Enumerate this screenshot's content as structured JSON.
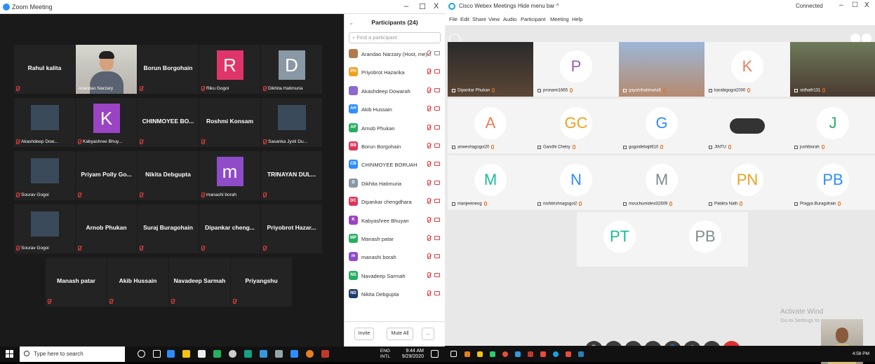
{
  "zoom": {
    "window_title": "Zoom Meeting",
    "window_controls": {
      "minimize": "–",
      "restore": "☐",
      "close": "X"
    },
    "grid": [
      {
        "name": "Rahul kalita",
        "caption": "",
        "type": "name",
        "muted": true
      },
      {
        "name": "",
        "caption": "Arandao Narzary",
        "type": "video",
        "highlight": true,
        "muted": false
      },
      {
        "name": "Borun Borgohain",
        "caption": "",
        "type": "name",
        "muted": true
      },
      {
        "name": "R",
        "caption": "Riku Gogoi",
        "type": "avatar",
        "color": "#e0356b",
        "muted": true
      },
      {
        "name": "D",
        "caption": "Dikhita Hatimuria",
        "type": "avatar",
        "color": "#8a97a5",
        "muted": true
      },
      {
        "name": "",
        "caption": "Akashdeep Dow...",
        "type": "photo",
        "muted": true
      },
      {
        "name": "K",
        "caption": "Kabyashree Bhuy...",
        "type": "avatar",
        "color": "#9a44c4",
        "muted": true
      },
      {
        "name": "CHINMOYEE BO...",
        "caption": "",
        "type": "name",
        "muted": true
      },
      {
        "name": "Roshmi Konsam",
        "caption": "",
        "type": "name",
        "muted": true
      },
      {
        "name": "",
        "caption": "Sasanka Jyoti Du...",
        "type": "photo",
        "muted": true
      },
      {
        "name": "",
        "caption": "Sourav Gogoi",
        "type": "photo",
        "muted": true
      },
      {
        "name": "Priyam Polly Go...",
        "caption": "",
        "type": "name",
        "muted": true
      },
      {
        "name": "Nikita Debgupta",
        "caption": "",
        "type": "name",
        "muted": true
      },
      {
        "name": "m",
        "caption": "manashi borah",
        "type": "avatar",
        "color": "#8e4cc9",
        "muted": true
      },
      {
        "name": "TRINAYAN DUL...",
        "caption": "",
        "type": "name",
        "muted": true
      },
      {
        "name": "",
        "caption": "Sourav Gogoi",
        "type": "photo",
        "muted": true
      },
      {
        "name": "Arnob Phukan",
        "caption": "",
        "type": "name",
        "muted": true
      },
      {
        "name": "Suraj Buragohain",
        "caption": "",
        "type": "name",
        "muted": true
      },
      {
        "name": "Dipankar cheng...",
        "caption": "",
        "type": "name",
        "muted": true
      },
      {
        "name": "Priyobrot Hazar...",
        "caption": "",
        "type": "name",
        "muted": true
      },
      {
        "name": "Manash patar",
        "caption": "",
        "type": "name",
        "muted": true
      },
      {
        "name": "Akib Hussain",
        "caption": "",
        "type": "name",
        "muted": true
      },
      {
        "name": "Navadeep Sarmah",
        "caption": "",
        "type": "name",
        "muted": true
      },
      {
        "name": "Priyangshu",
        "caption": "",
        "type": "name",
        "muted": true
      }
    ],
    "participants": {
      "title": "Participants (24)",
      "search_placeholder": "Find a participant",
      "list": [
        {
          "initials": "",
          "name": "Arandao Narzary (Host, me)",
          "color": "#b07a4a",
          "muted": false
        },
        {
          "initials": "PH",
          "name": "Priyobrot Hazarika",
          "color": "#f0a020",
          "muted": true
        },
        {
          "initials": "",
          "name": "Akashdeep Dowarah",
          "color": "#8a6ad0",
          "muted": true
        },
        {
          "initials": "AH",
          "name": "Akib Hussain",
          "color": "#2d8cff",
          "muted": true
        },
        {
          "initials": "AP",
          "name": "Arnob Phukan",
          "color": "#27ae60",
          "muted": true
        },
        {
          "initials": "BB",
          "name": "Borun Borgohain",
          "color": "#e0355a",
          "muted": true
        },
        {
          "initials": "CB",
          "name": "CHINMOYEE BORUAH",
          "color": "#2d8cff",
          "muted": true
        },
        {
          "initials": "D",
          "name": "Dikhita Hatimuria",
          "color": "#8a97a5",
          "muted": true
        },
        {
          "initials": "DC",
          "name": "Dipankar chengdhara",
          "color": "#e0355a",
          "muted": true
        },
        {
          "initials": "K",
          "name": "Kabyashree Bhuyan",
          "color": "#9a44c4",
          "muted": true
        },
        {
          "initials": "MP",
          "name": "Manash patar",
          "color": "#27ae60",
          "muted": true
        },
        {
          "initials": "m",
          "name": "manashi borah",
          "color": "#8e4cc9",
          "muted": true
        },
        {
          "initials": "NS",
          "name": "Navadeep Sarmah",
          "color": "#27ae60",
          "muted": true
        },
        {
          "initials": "ND",
          "name": "Nikita Debgupta",
          "color": "#1f3a6e",
          "muted": true
        }
      ],
      "invite_label": "Invite",
      "mute_all_label": "Mute All",
      "more_label": "..."
    },
    "taskbar": {
      "search_placeholder": "Type here to search",
      "lang": "ENG",
      "region": "INTL",
      "time": "9:44 AM",
      "date": "9/29/2020"
    }
  },
  "webex": {
    "window_title": "Cisco Webex Meetings",
    "hide_menu": "Hide menu bar ^",
    "status": "Connected",
    "window_controls": {
      "minimize": "–",
      "restore": "☐",
      "close": "X"
    },
    "menu": [
      "File",
      "Edit",
      "Share",
      "View",
      "Audio",
      "Participant",
      "Meeting",
      "Help"
    ],
    "tiles": [
      {
        "initials": "",
        "label": "Dipankar Phukan",
        "video": true,
        "color": ""
      },
      {
        "initials": "P",
        "label": "pronami1665",
        "video": false,
        "color": "#9b59b6"
      },
      {
        "initials": "",
        "label": "gayatrihatimuria5",
        "video": true,
        "color": ""
      },
      {
        "initials": "K",
        "label": "karabigogoi2000",
        "video": false,
        "color": "#e67e5e"
      },
      {
        "initials": "",
        "label": "sidhath131",
        "video": true,
        "color": ""
      },
      {
        "initials": "A",
        "label": "anweshagogoi20",
        "video": false,
        "color": "#e67e5e"
      },
      {
        "initials": "GC",
        "label": "Gandhi Chetry",
        "video": false,
        "color": "#f0a020"
      },
      {
        "initials": "G",
        "label": "gogoidebajit610",
        "video": false,
        "color": "#2d8cff"
      },
      {
        "initials": "",
        "label": "JINTU",
        "video": false,
        "color": ""
      },
      {
        "initials": "J",
        "label": "jushiborah",
        "video": false,
        "color": "#27ae60"
      },
      {
        "initials": "M",
        "label": "manjeetneog",
        "video": false,
        "color": "#1abc9c"
      },
      {
        "initials": "N",
        "label": "nishitrishnagogoi2",
        "video": false,
        "color": "#2d8cff"
      },
      {
        "initials": "M",
        "label": "mouchumidevi32609",
        "video": false,
        "color": "#7f8c8d"
      },
      {
        "initials": "PN",
        "label": "Pabitra Nath",
        "video": false,
        "color": "#f0a020"
      },
      {
        "initials": "PB",
        "label": "Pragya Buragohain",
        "video": false,
        "color": "#2d8cff"
      },
      {
        "initials": "PT",
        "label": "",
        "video": false,
        "color": "#1abc9c"
      },
      {
        "initials": "PB",
        "label": "",
        "video": false,
        "color": "#7f8c8d"
      }
    ],
    "activate": {
      "line1": "Activate Wind",
      "line2": "Go to Settings to"
    },
    "taskbar": {
      "time": "4:58 PM"
    }
  }
}
